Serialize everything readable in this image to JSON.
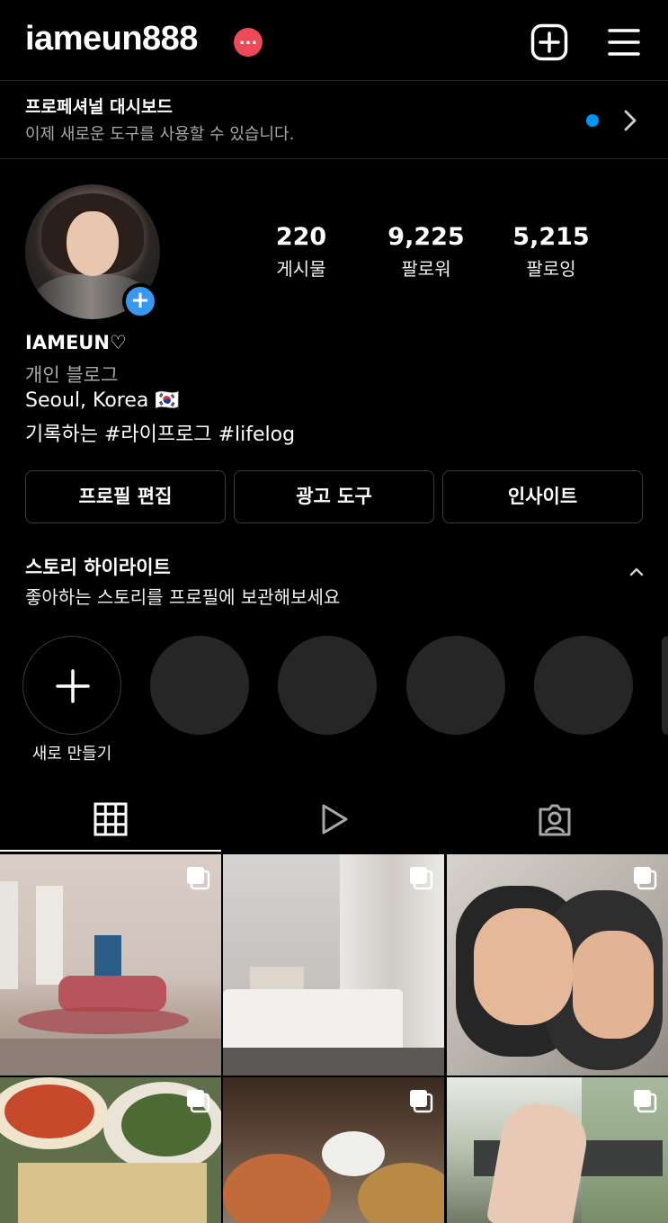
{
  "header": {
    "username": "iameun888",
    "badge": "...",
    "add_icon": "plus-square-icon",
    "menu_icon": "hamburger-menu-icon"
  },
  "pro_dashboard": {
    "title": "프로페셔널 대시보드",
    "subtitle": "이제 새로운 도구를 사용할 수 있습니다.",
    "dot_color": "#0095f6"
  },
  "profile": {
    "stats": [
      {
        "value": "220",
        "label": "게시물"
      },
      {
        "value": "9,225",
        "label": "팔로워"
      },
      {
        "value": "5,215",
        "label": "팔로잉"
      }
    ],
    "name": "IAMEUN♡",
    "category": "개인 블로그",
    "location": "Seoul, Korea 🇰🇷",
    "bio": "기록하는 #라이프로그 #lifelog"
  },
  "actions": {
    "edit_profile": "프로필 편집",
    "ad_tools": "광고 도구",
    "insights": "인사이트"
  },
  "highlights": {
    "title": "스토리 하이라이트",
    "subtitle": "좋아하는 스토리를 프로필에 보관해보세요",
    "new_label": "새로 만들기"
  },
  "tabs": [
    {
      "icon": "grid-icon",
      "selected": true
    },
    {
      "icon": "reels-play-icon",
      "selected": false
    },
    {
      "icon": "tagged-person-icon",
      "selected": false
    }
  ],
  "colors": {
    "background": "#000000",
    "badge": "#ed4956",
    "accent_blue": "#3897f0",
    "secondary_text": "#a8a8a8",
    "placeholder": "#262626"
  }
}
